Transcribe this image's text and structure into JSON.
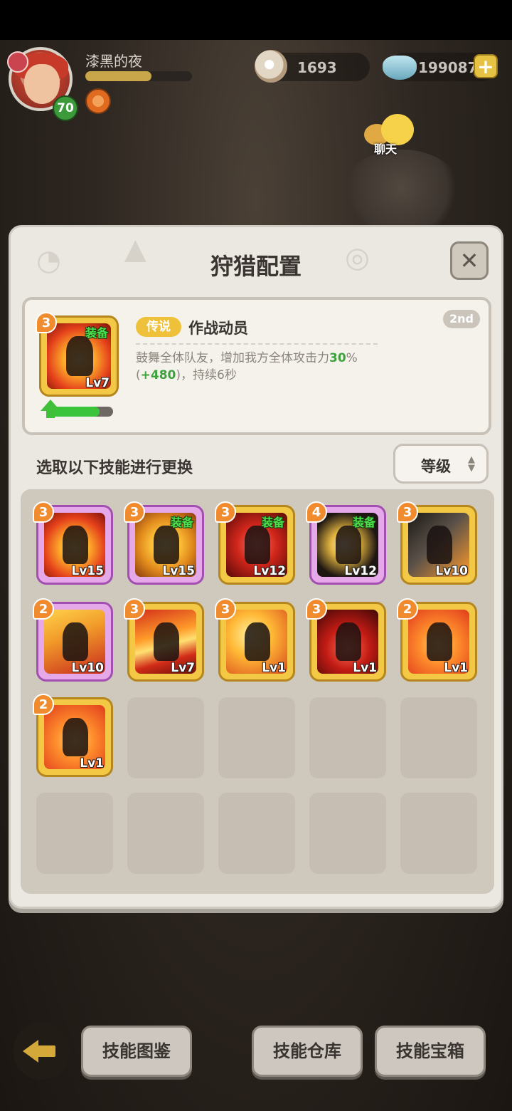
{
  "player": {
    "name": "漆黑的夜",
    "level": "70",
    "xp_fraction": 0.62
  },
  "resources": {
    "shells": "1693",
    "gems": "199087"
  },
  "chat": {
    "label": "聊天"
  },
  "panel": {
    "title": "狩猎配置",
    "close_icon": "close-icon",
    "featured": {
      "rank": "2nd",
      "rarity": "传说",
      "name": "作战动员",
      "desc_before": "鼓舞全体队友，增加我方全体攻击力",
      "desc_pct": "30",
      "desc_pct_unit": "%",
      "desc_paren_open": "(",
      "desc_bonus": "+480",
      "desc_after": ")，持续6秒",
      "card": {
        "num": "3",
        "equip": "装备",
        "lv": "Lv7"
      },
      "progress_fraction": 0.8
    },
    "instruction": "选取以下技能进行更换",
    "sort_label": "等级",
    "skills": [
      {
        "num": "3",
        "equip": "",
        "lv": "Lv15",
        "frame": "purple",
        "art": "fire"
      },
      {
        "num": "3",
        "equip": "装备",
        "lv": "Lv15",
        "frame": "purple",
        "art": "shield"
      },
      {
        "num": "3",
        "equip": "装备",
        "lv": "Lv12",
        "frame": "gold",
        "art": "red"
      },
      {
        "num": "4",
        "equip": "装备",
        "lv": "Lv12",
        "frame": "purple",
        "art": "dark"
      },
      {
        "num": "3",
        "equip": "",
        "lv": "Lv10",
        "frame": "gold",
        "art": "grey"
      },
      {
        "num": "2",
        "equip": "",
        "lv": "Lv10",
        "frame": "purple",
        "art": "beast"
      },
      {
        "num": "3",
        "equip": "",
        "lv": "Lv7",
        "frame": "gold",
        "art": "slash"
      },
      {
        "num": "3",
        "equip": "",
        "lv": "Lv1",
        "frame": "gold",
        "art": "block"
      },
      {
        "num": "3",
        "equip": "",
        "lv": "Lv1",
        "frame": "gold",
        "art": "demon"
      },
      {
        "num": "2",
        "equip": "",
        "lv": "Lv1",
        "frame": "gold",
        "art": "hero"
      },
      {
        "num": "2",
        "equip": "",
        "lv": "Lv1",
        "frame": "gold",
        "art": "hero"
      }
    ],
    "empty_slots": 9
  },
  "buttons": {
    "back_icon": "back-arrow-icon",
    "codex": "技能图鉴",
    "warehouse": "技能仓库",
    "chest": "技能宝箱"
  }
}
